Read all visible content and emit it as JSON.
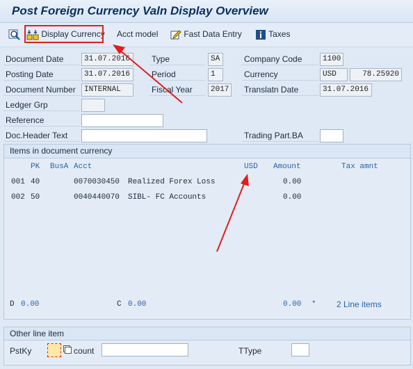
{
  "title": "Post Foreign Currency Valn Display Overview",
  "toolbar": {
    "display_currency": "Display Currency",
    "acct_model": "Acct model",
    "fast_data_entry": "Fast Data Entry",
    "taxes": "Taxes"
  },
  "header": {
    "document_date_label": "Document Date",
    "document_date": "31.07.2016",
    "type_label": "Type",
    "type": "SA",
    "company_code_label": "Company Code",
    "company_code": "1100",
    "posting_date_label": "Posting Date",
    "posting_date": "31.07.2016",
    "period_label": "Period",
    "period": "1",
    "currency_label": "Currency",
    "currency": "USD",
    "exchange_rate": "78.25920",
    "document_number_label": "Document Number",
    "document_number": "INTERNAL",
    "fiscal_year_label": "Fiscal Year",
    "fiscal_year": "2017",
    "translatn_date_label": "Translatn Date",
    "translatn_date": "31.07.2016",
    "ledger_grp_label": "Ledger Grp",
    "reference_label": "Reference",
    "doc_header_text_label": "Doc.Header Text",
    "trading_part_label": "Trading Part.BA"
  },
  "items": {
    "group_title": "Items in document currency",
    "col_pk": "PK",
    "col_busa": "BusA",
    "col_acct": "Acct",
    "col_currency": "USD",
    "col_amount": "Amount",
    "col_tax": "Tax amnt",
    "rows": [
      {
        "no": "001",
        "pk": "40",
        "acct": "0070030450",
        "desc": "Realized Forex Loss",
        "amount": "0.00"
      },
      {
        "no": "002",
        "pk": "50",
        "acct": "0040440070",
        "desc": "SIBL- FC Accounts",
        "amount": "0.00"
      }
    ],
    "d_label": "D",
    "d_value": "0.00",
    "c_label": "C",
    "c_value": "0.00",
    "total": "0.00",
    "star": "*",
    "line_items": "2 Line items"
  },
  "other": {
    "group_title": "Other line item",
    "pstky_label": "PstKy",
    "count_label": "count",
    "ttype_label": "TType"
  },
  "colors": {
    "annotation": "#e21d1d",
    "accent": "#2a5fa8"
  }
}
